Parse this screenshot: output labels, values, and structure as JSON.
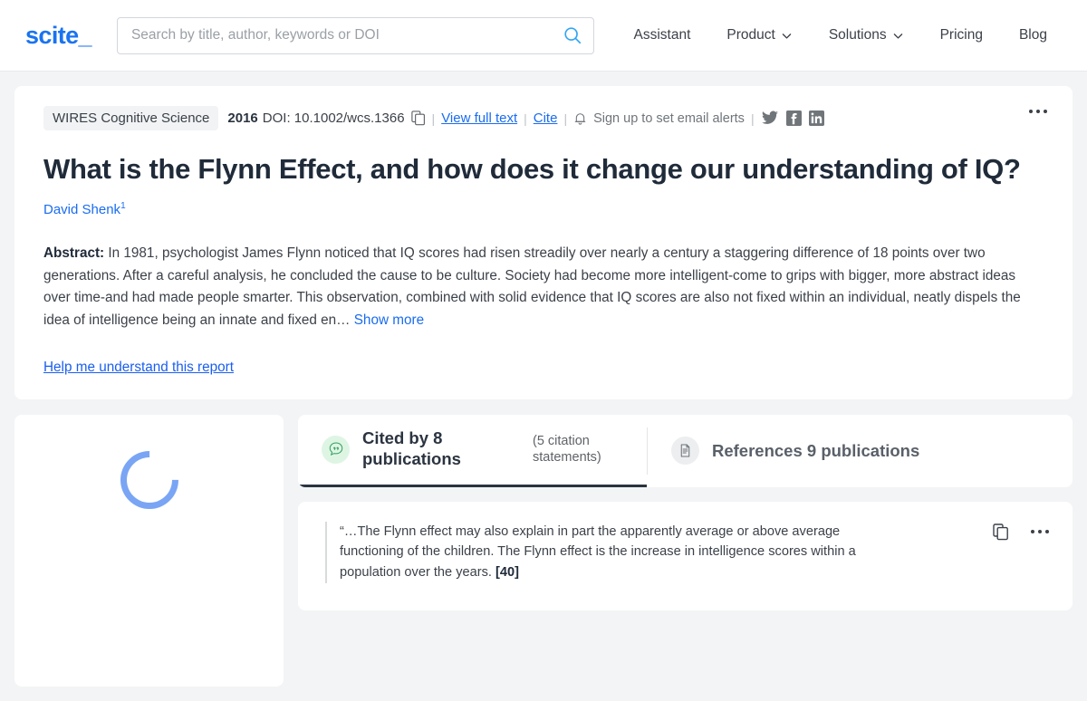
{
  "header": {
    "logo": "scite_",
    "search": {
      "placeholder": "Search by title, author, keywords or DOI",
      "value": ""
    },
    "nav": [
      {
        "label": "Assistant",
        "caret": false
      },
      {
        "label": "Product",
        "caret": true
      },
      {
        "label": "Solutions",
        "caret": true
      },
      {
        "label": "Pricing",
        "caret": false
      },
      {
        "label": "Blog",
        "caret": false
      }
    ],
    "caret_glyph": "⌄"
  },
  "paper": {
    "journal": "WIRES Cognitive Science",
    "year": "2016",
    "doi": "DOI: 10.1002/wcs.1366",
    "copy_doi_icon": "copy-icon",
    "view_full_text": "View full text",
    "cite": "Cite",
    "alerts_label": "Sign up to set email alerts",
    "alerts_icon": "bell-icon",
    "separator": "|",
    "socials": [
      "twitter-icon",
      "facebook-icon",
      "linkedin-icon"
    ],
    "more_menu": "…",
    "title": "What is the Flynn Effect, and how does it change our understanding of IQ?",
    "authors": [
      {
        "name": "David Shenk",
        "affiliation": "1"
      }
    ],
    "abstract_label": "Abstract:",
    "abstract_text": "In 1981, psychologist James Flynn noticed that IQ scores had risen streadily over nearly a century a staggering difference of 18 points over two generations. After a careful analysis, he concluded the cause to be culture. Society had become more intelligent-come to grips with bigger, more abstract ideas over time-and had made people smarter. This observation, combined with solid evidence that IQ scores are also not fixed within an individual, neatly dispels the idea of intelligence being an innate and fixed en…",
    "show_more": "Show more",
    "help_link": "Help me understand this report"
  },
  "sidebar": {
    "loading_icon": "loading-spinner"
  },
  "tabs": [
    {
      "id": "cited-by",
      "icon": "quote-bubble-icon",
      "main_label": "Cited by 8 publications",
      "sub_label": "(5 citation statements)",
      "active": true
    },
    {
      "id": "references",
      "icon": "document-icon",
      "main_label": "References 9 publications",
      "sub_label": "",
      "active": false
    }
  ],
  "statement": {
    "text": "“…The Flynn effect may also explain in part the apparently average or above average functioning of the children. The Flynn effect is the increase in intelligence scores within a population over the years.",
    "ref_tag": "[40]",
    "copy_icon": "copy-icon",
    "more_icon": "…"
  },
  "colors": {
    "brand_blue": "#1a73f0",
    "link_blue": "#1a6cf0",
    "page_bg": "#f3f4f5",
    "cited_green": "#dff5e4",
    "spinner_blue": "#7aa5f5"
  }
}
